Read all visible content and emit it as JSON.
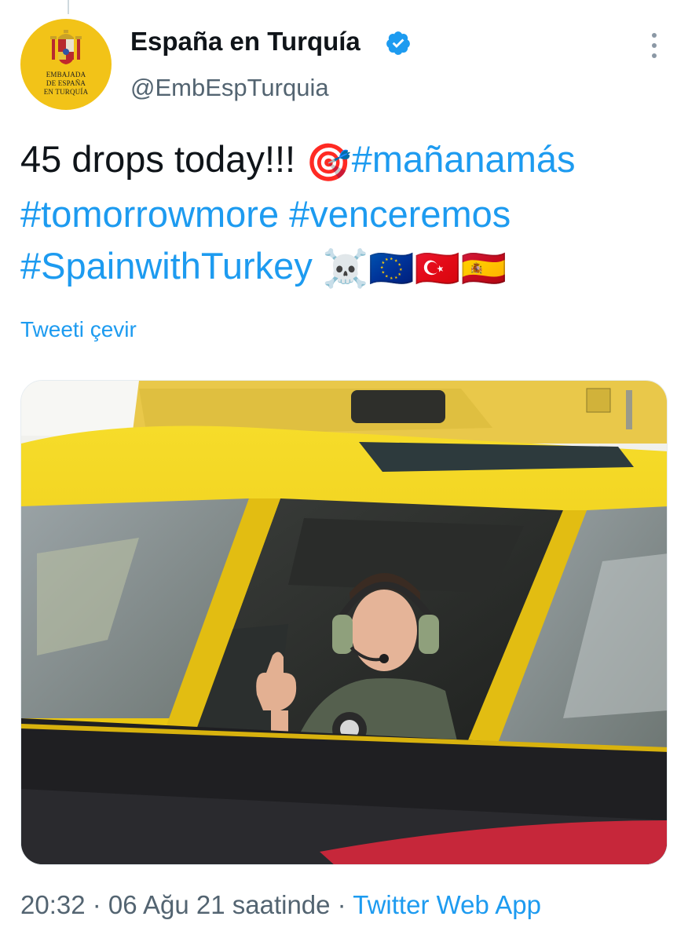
{
  "author": {
    "display_name": "España en Turquía",
    "handle": "@EmbEspTurquia",
    "avatar_text": [
      "EMBAJADA",
      "DE ESPAÑA",
      "EN TURQUÍA"
    ],
    "verified_icon": "verified-badge-icon"
  },
  "tweet": {
    "line1_text": "45 drops today!!! ",
    "line1_emoji": "🎯",
    "hashtag1": "#mañanamás",
    "hashtag2": "#tomorrowmore",
    "hashtag3": "#venceremos",
    "hashtag4": "#SpainwithTurkey",
    "emojis_end": "☠️🇪🇺🇹🇷🇪🇸"
  },
  "translate_label": "Tweeti çevir",
  "meta": {
    "time": "20:32",
    "separator": " · ",
    "date_text": "06 Ağu 21 saatinde",
    "source": "Twitter Web App"
  },
  "colors": {
    "accent": "#1d9bf0",
    "text": "#0f1419",
    "secondary": "#536471",
    "avatar_bg": "#f2c318",
    "aircraft_yellow": "#f3d21a"
  },
  "icons": [
    "more-options-icon",
    "verified-badge-icon",
    "coat-of-arms-icon"
  ]
}
